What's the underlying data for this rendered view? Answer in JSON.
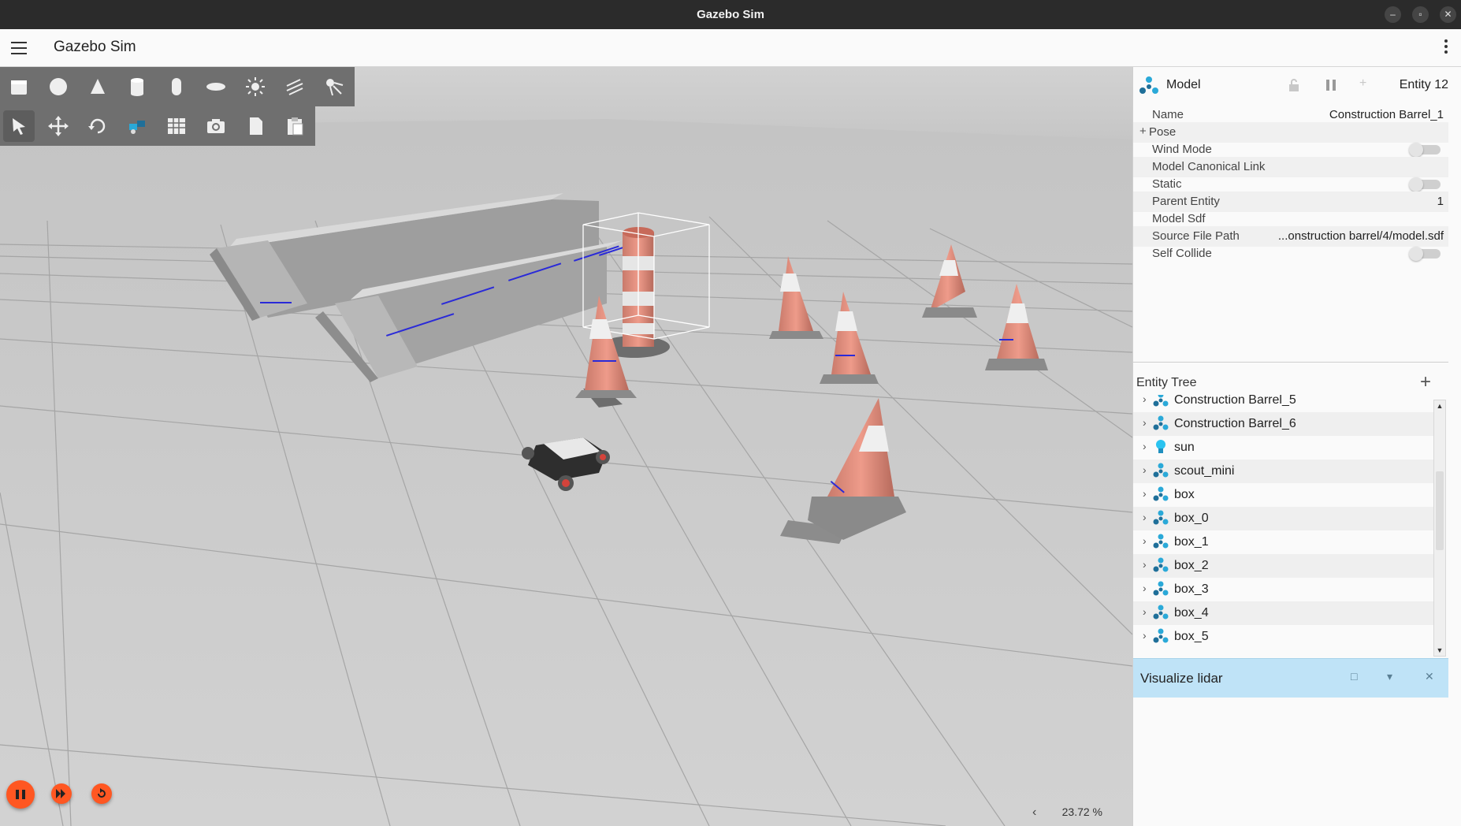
{
  "window": {
    "title": "Gazebo Sim"
  },
  "app": {
    "title": "Gazebo Sim"
  },
  "toolbar": {
    "shapes": [
      "box-icon",
      "sphere-icon",
      "cone-icon",
      "cylinder-icon",
      "capsule-icon",
      "ellipsoid-icon",
      "sun-icon",
      "directional-light-icon",
      "spot-light-icon"
    ],
    "tools": [
      "select-icon",
      "translate-icon",
      "rotate-icon",
      "transform-control-icon",
      "grid-snap-icon",
      "screenshot-icon",
      "copy-icon",
      "paste-icon"
    ]
  },
  "viewport": {
    "rtf": "23.72 %"
  },
  "component_inspector": {
    "type": "Model",
    "entity": "Entity 12",
    "rows": [
      {
        "label": "Name",
        "value": "Construction Barrel_1",
        "kind": "text"
      },
      {
        "label": "Pose",
        "value": "",
        "kind": "expand"
      },
      {
        "label": "Wind Mode",
        "value": "",
        "kind": "toggle"
      },
      {
        "label": "Model Canonical Link",
        "value": "",
        "kind": "text"
      },
      {
        "label": "Static",
        "value": "",
        "kind": "toggle"
      },
      {
        "label": "Parent Entity",
        "value": "1",
        "kind": "text"
      },
      {
        "label": "Model Sdf",
        "value": "",
        "kind": "text"
      },
      {
        "label": "Source File Path",
        "value": "...onstruction barrel/4/model.sdf",
        "kind": "text"
      },
      {
        "label": "Self Collide",
        "value": "",
        "kind": "toggle"
      }
    ]
  },
  "entity_tree": {
    "title": "Entity Tree",
    "items": [
      {
        "label": "Construction Barrel_5",
        "icon": "model-icon"
      },
      {
        "label": "Construction Barrel_6",
        "icon": "model-icon"
      },
      {
        "label": "sun",
        "icon": "light-bulb-icon"
      },
      {
        "label": "scout_mini",
        "icon": "model-icon"
      },
      {
        "label": "box",
        "icon": "model-icon"
      },
      {
        "label": "box_0",
        "icon": "model-icon"
      },
      {
        "label": "box_1",
        "icon": "model-icon"
      },
      {
        "label": "box_2",
        "icon": "model-icon"
      },
      {
        "label": "box_3",
        "icon": "model-icon"
      },
      {
        "label": "box_4",
        "icon": "model-icon"
      },
      {
        "label": "box_5",
        "icon": "model-icon"
      }
    ]
  },
  "plugin": {
    "title": "Visualize lidar"
  },
  "colors": {
    "accent": "#ff5722",
    "plugin_bar": "#bfe3f7",
    "toolbar": "#6f6f6f",
    "model_icon": "#2aa9d8"
  }
}
